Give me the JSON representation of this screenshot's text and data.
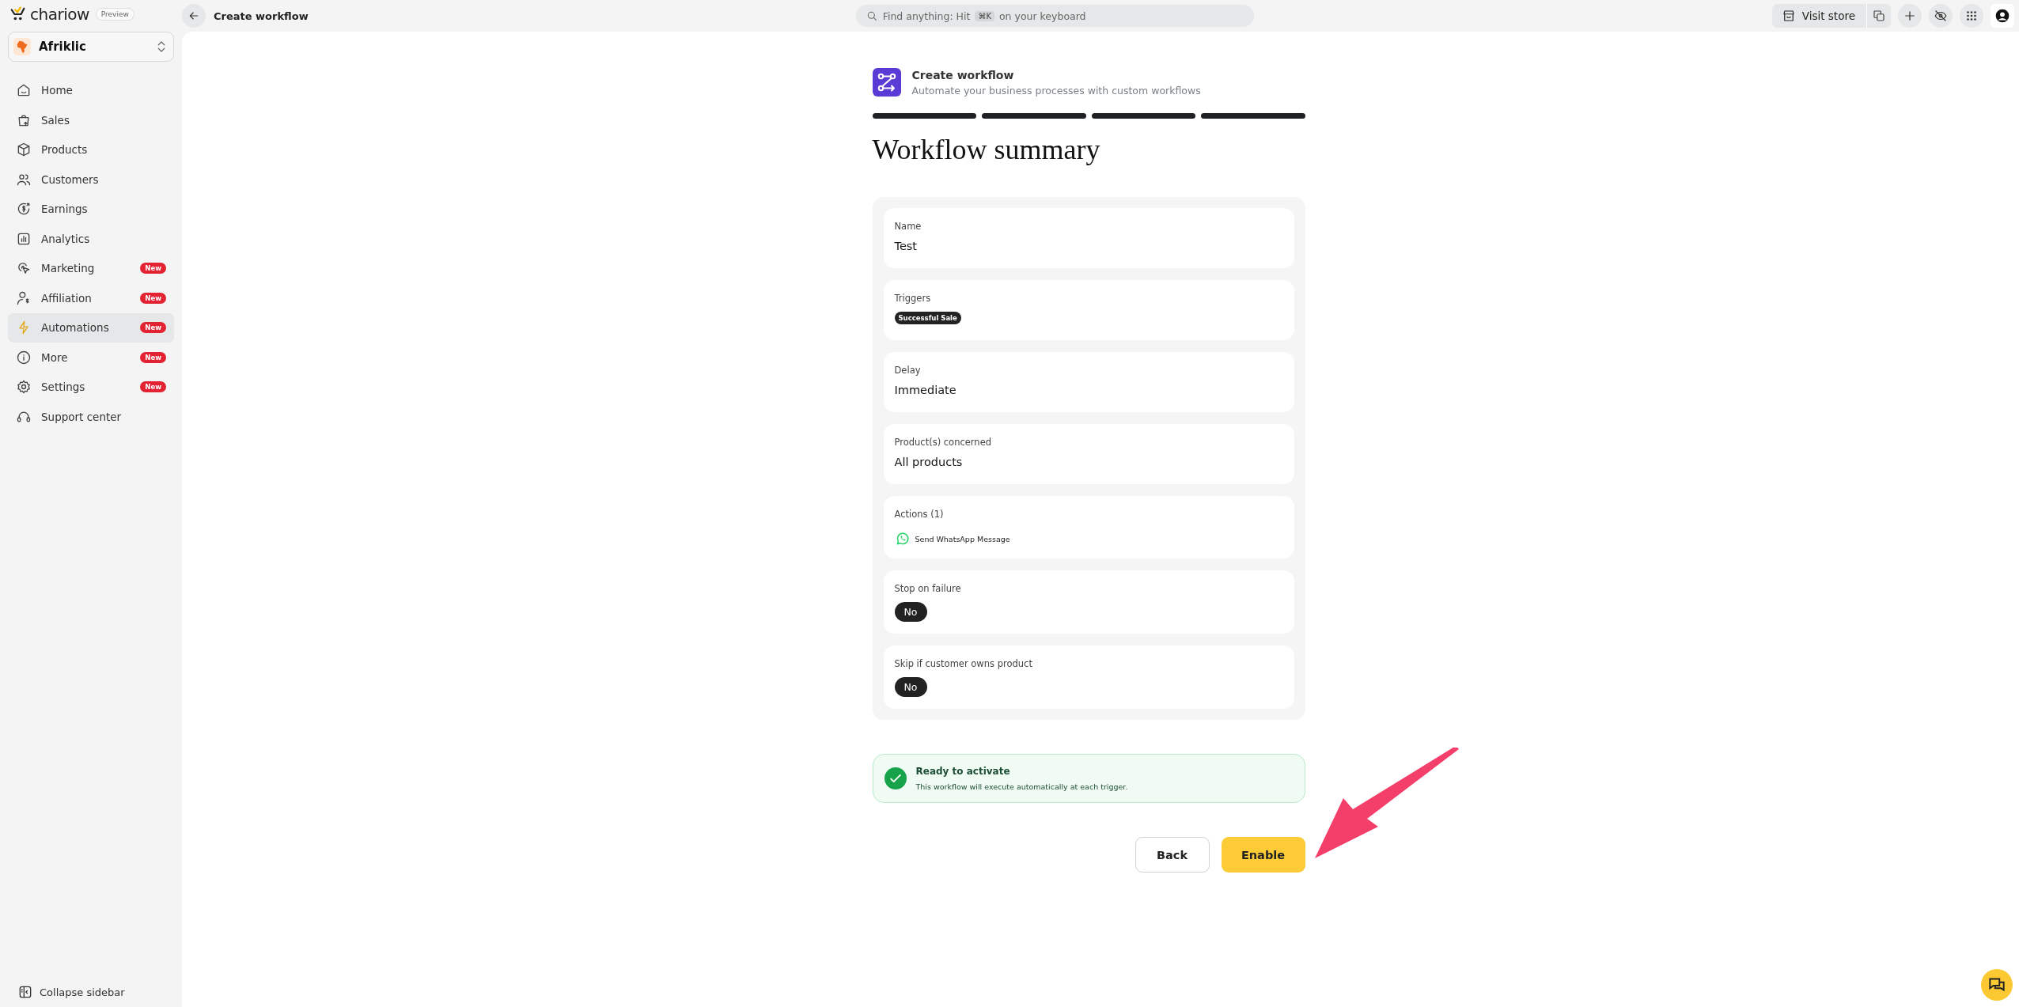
{
  "brand": {
    "name": "chariow",
    "badge": "Preview"
  },
  "workspace": {
    "name": "Afriklic"
  },
  "sidebar": {
    "items": [
      {
        "label": "Home",
        "selected": false
      },
      {
        "label": "Sales",
        "selected": false
      },
      {
        "label": "Products",
        "selected": false
      },
      {
        "label": "Customers",
        "selected": false
      },
      {
        "label": "Earnings",
        "selected": false
      },
      {
        "label": "Analytics",
        "selected": false
      },
      {
        "label": "Marketing",
        "selected": false,
        "badge": "New"
      },
      {
        "label": "Affiliation",
        "selected": false,
        "badge": "New"
      },
      {
        "label": "Automations",
        "selected": true,
        "badge": "New"
      },
      {
        "label": "More",
        "selected": false,
        "badge": "New"
      },
      {
        "label": "Settings",
        "selected": false,
        "badge": "New"
      },
      {
        "label": "Support center",
        "selected": false
      }
    ],
    "collapse": "Collapse sidebar"
  },
  "topbar": {
    "title": "Create workflow",
    "search": {
      "before": "Find anything: Hit",
      "key": "⌘K",
      "after": "on your keyboard"
    },
    "visit_store": "Visit store"
  },
  "header": {
    "title": "Create workflow",
    "subtitle": "Automate your business processes with custom workflows"
  },
  "steps": [
    {
      "done": true
    },
    {
      "done": true
    },
    {
      "done": true
    },
    {
      "done": true
    }
  ],
  "heading": "Workflow summary",
  "summary": [
    {
      "kind": "text",
      "label": "Name",
      "value": "Test"
    },
    {
      "kind": "tags",
      "label": "Triggers",
      "tags": [
        "Successful Sale"
      ]
    },
    {
      "kind": "text",
      "label": "Delay",
      "value": "Immediate"
    },
    {
      "kind": "text",
      "label": "Product(s) concerned",
      "value": "All products"
    },
    {
      "kind": "actions",
      "label": "Actions (1)",
      "actions": [
        "Send WhatsApp Message"
      ]
    },
    {
      "kind": "pill",
      "label": "Stop on failure",
      "value": "No"
    },
    {
      "kind": "pill",
      "label": "Skip if customer owns product",
      "value": "No"
    }
  ],
  "notice": {
    "title": "Ready to activate",
    "text": "This workflow will execute automatically at each trigger."
  },
  "buttons": [
    {
      "kind": "secondary",
      "label": "Back"
    },
    {
      "kind": "primary",
      "label": "Enable"
    }
  ]
}
